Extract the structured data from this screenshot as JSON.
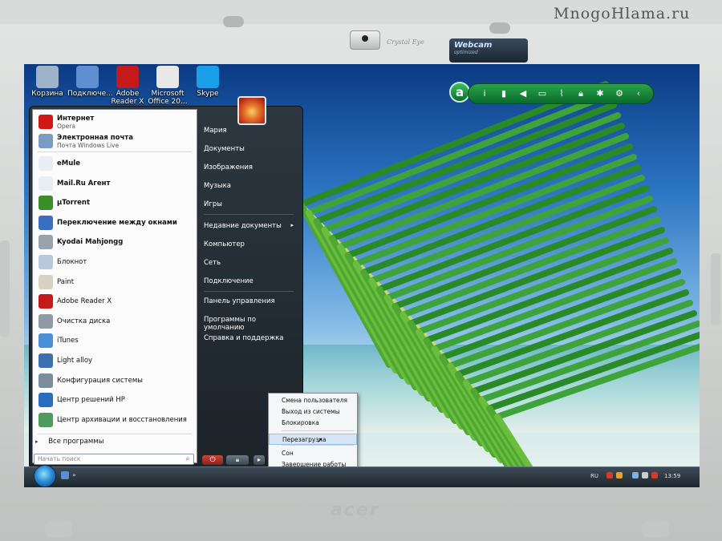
{
  "watermark": "MnogoHlama.ru",
  "bezel": {
    "camera_label": "Crystal Eye",
    "sticker_title": "Webcam",
    "sticker_sub": "optimized",
    "brand": "acer"
  },
  "desktop_icons": [
    {
      "label": "Корзина",
      "icon": "recycle-bin-icon",
      "color": "#9fb3c8"
    },
    {
      "label": "Подключе...",
      "icon": "network-icon",
      "color": "#5f8fd0"
    },
    {
      "label": "Adobe Reader X",
      "icon": "adobe-reader-icon",
      "color": "#c41a1a"
    },
    {
      "label": "Microsoft Office 20...",
      "icon": "office-icon",
      "color": "#e8e8e8"
    },
    {
      "label": "Skype",
      "icon": "skype-icon",
      "color": "#1aa0e8"
    }
  ],
  "gadgets": {
    "logo": "a",
    "buttons": [
      "info-icon",
      "battery-icon",
      "volume-icon",
      "display-icon",
      "wireless-icon",
      "lock-icon",
      "bluetooth-icon",
      "settings-icon",
      "collapse-icon"
    ]
  },
  "start_menu": {
    "pinned": [
      {
        "title": "Интернет",
        "subtitle": "Opera",
        "icon": "opera-icon",
        "color": "#d01a1a"
      },
      {
        "title": "Электронная почта",
        "subtitle": "Почта Windows Live",
        "icon": "mail-icon",
        "color": "#7a9cc4"
      }
    ],
    "recent": [
      {
        "label": "eMule",
        "icon": "emule-icon",
        "color": "#e8eef4",
        "bold": true
      },
      {
        "label": "Mail.Ru Агент",
        "icon": "mailru-agent-icon",
        "color": "#e8eef4",
        "bold": true
      },
      {
        "label": "µTorrent",
        "icon": "utorrent-icon",
        "color": "#3a8f2b",
        "bold": true
      },
      {
        "label": "Переключение между окнами",
        "icon": "switch-windows-icon",
        "color": "#3a6fc0",
        "bold": true
      },
      {
        "label": "Kyodai Mahjongg",
        "icon": "mahjongg-icon",
        "color": "#9aa3ad",
        "bold": true
      },
      {
        "label": "Блокнот",
        "icon": "notepad-icon",
        "color": "#b7c9db",
        "bold": false
      },
      {
        "label": "Paint",
        "icon": "paint-icon",
        "color": "#d9d2c4",
        "bold": false
      },
      {
        "label": "Adobe Reader X",
        "icon": "adobe-reader-icon",
        "color": "#c41a1a",
        "bold": false
      },
      {
        "label": "Очистка диска",
        "icon": "disk-cleanup-icon",
        "color": "#8e9aa6",
        "bold": false
      },
      {
        "label": "iTunes",
        "icon": "itunes-icon",
        "color": "#4b8fd6",
        "bold": false
      },
      {
        "label": "Light alloy",
        "icon": "lightalloy-icon",
        "color": "#3b6fb0",
        "bold": false
      },
      {
        "label": "Конфигурация системы",
        "icon": "msconfig-icon",
        "color": "#7b8c9c",
        "bold": false
      },
      {
        "label": "Центр решений HP",
        "icon": "hp-icon",
        "color": "#2a6cc0",
        "bold": false
      },
      {
        "label": "Центр архивации и восстановления",
        "icon": "backup-icon",
        "color": "#4f9a5c",
        "bold": false
      }
    ],
    "all_programs": "Все программы",
    "search_placeholder": "Начать поиск",
    "right_items": [
      {
        "label": "Мария",
        "arrow": false
      },
      {
        "label": "Документы",
        "arrow": false
      },
      {
        "label": "Изображения",
        "arrow": false
      },
      {
        "label": "Музыка",
        "arrow": false
      },
      {
        "label": "Игры",
        "arrow": false
      },
      {
        "label": "Недавние документы",
        "arrow": true
      },
      {
        "label": "Компьютер",
        "arrow": false
      },
      {
        "label": "Сеть",
        "arrow": false
      },
      {
        "label": "Подключение",
        "arrow": false
      },
      {
        "label": "Панель управления",
        "arrow": false
      },
      {
        "label": "Программы по умолчанию",
        "arrow": false
      },
      {
        "label": "Справка и поддержка",
        "arrow": false
      }
    ]
  },
  "power_menu": {
    "items": [
      {
        "label": "Смена пользователя",
        "highlighted": false
      },
      {
        "label": "Выход из системы",
        "highlighted": false
      },
      {
        "label": "Блокировка",
        "highlighted": false
      },
      {
        "label": "Перезагрузка",
        "highlighted": true
      },
      {
        "label": "Сон",
        "highlighted": false
      },
      {
        "label": "Завершение работы",
        "highlighted": false
      }
    ]
  },
  "taskbar": {
    "language": "RU",
    "time": "13:59"
  }
}
